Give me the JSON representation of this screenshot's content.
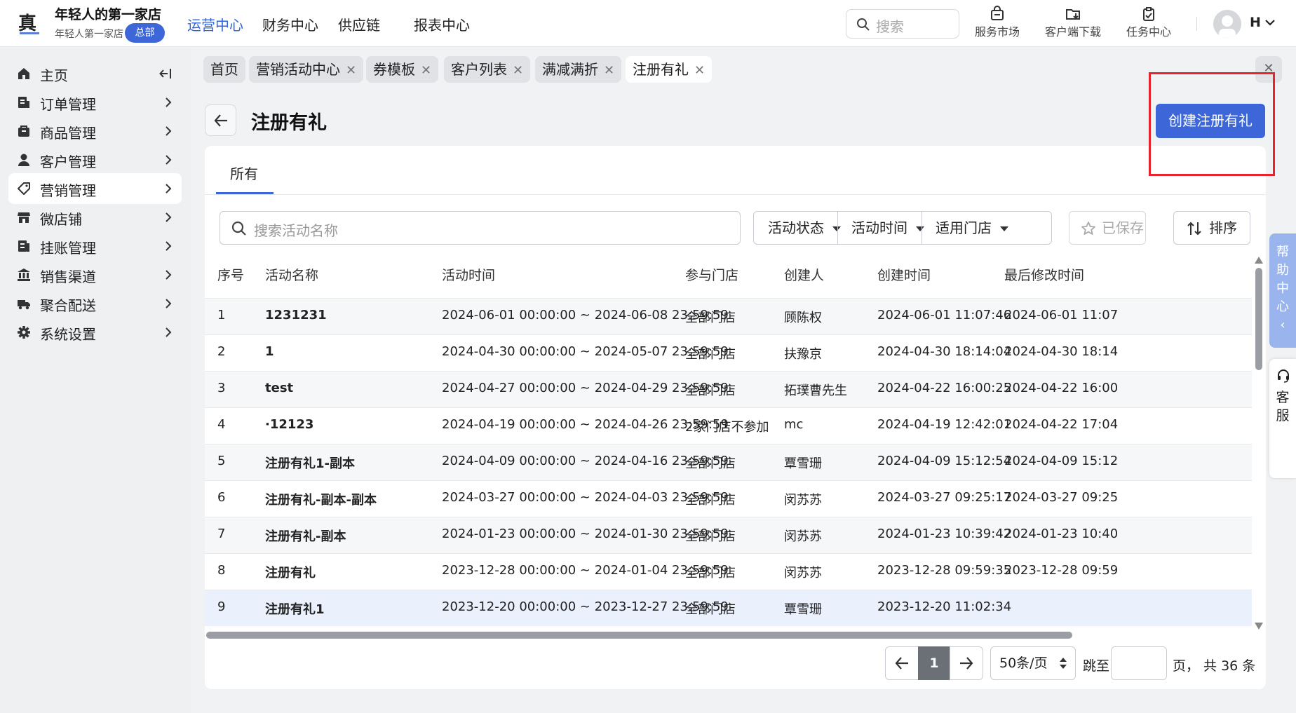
{
  "header": {
    "store_name": "年轻人的第一家店",
    "store_sub": "年轻人第一家店",
    "badge": "总部",
    "nav": [
      "运营中心",
      "财务中心",
      "供应链",
      "报表中心"
    ],
    "active_nav": "运营中心",
    "search_placeholder": "搜索",
    "tools": [
      "服务市场",
      "客户端下载",
      "任务中心"
    ],
    "user_initial": "H"
  },
  "sidebar": {
    "items": [
      {
        "label": "主页",
        "icon": "home-icon"
      },
      {
        "label": "订单管理",
        "icon": "order-icon"
      },
      {
        "label": "商品管理",
        "icon": "product-icon"
      },
      {
        "label": "客户管理",
        "icon": "customer-icon"
      },
      {
        "label": "营销管理",
        "icon": "tag-icon"
      },
      {
        "label": "微店铺",
        "icon": "store-icon"
      },
      {
        "label": "挂账管理",
        "icon": "ledger-icon"
      },
      {
        "label": "销售渠道",
        "icon": "channel-icon"
      },
      {
        "label": "聚合配送",
        "icon": "truck-icon"
      },
      {
        "label": "系统设置",
        "icon": "gear-icon"
      }
    ],
    "active_index": 4
  },
  "tabs": [
    {
      "label": "首页",
      "closable": false
    },
    {
      "label": "营销活动中心",
      "closable": true
    },
    {
      "label": "券模板",
      "closable": true
    },
    {
      "label": "客户列表",
      "closable": true
    },
    {
      "label": "满减满折",
      "closable": true
    },
    {
      "label": "注册有礼",
      "closable": true
    }
  ],
  "page": {
    "title": "注册有礼",
    "create_button": "创建注册有礼",
    "card_tab": "所有",
    "search_placeholder": "搜索活动名称",
    "filters": [
      "活动状态",
      "活动时间",
      "适用门店"
    ],
    "saved_label": "已保存",
    "sort_label": "排序"
  },
  "table": {
    "headers": [
      "序号",
      "活动名称",
      "活动时间",
      "参与门店",
      "创建人",
      "创建时间",
      "最后修改时间"
    ],
    "rows": [
      [
        "1",
        "1231231",
        "2024-06-01 00:00:00 ~ 2024-06-08 23:59:59",
        "全部门店",
        "顾陈权",
        "2024-06-01 11:07:46",
        "2024-06-01 11:07"
      ],
      [
        "2",
        "1",
        "2024-04-30 00:00:00 ~ 2024-05-07 23:59:59",
        "全部门店",
        "扶豫京",
        "2024-04-30 18:14:04",
        "2024-04-30 18:14"
      ],
      [
        "3",
        "test",
        "2024-04-27 00:00:00 ~ 2024-04-29 23:59:59",
        "全部门店",
        "拓璞曹先生",
        "2024-04-22 16:00:25",
        "2024-04-22 16:00"
      ],
      [
        "4",
        "·12123",
        "2024-04-19 00:00:00 ~ 2024-04-26 23:59:59",
        "2家门店不参加",
        "mc",
        "2024-04-19 12:42:01",
        "2024-04-22 17:04"
      ],
      [
        "5",
        "注册有礼1-副本",
        "2024-04-09 00:00:00 ~ 2024-04-16 23:59:59",
        "全部门店",
        "覃雪珊",
        "2024-04-09 15:12:54",
        "2024-04-09 15:12"
      ],
      [
        "6",
        "注册有礼-副本-副本",
        "2024-03-27 00:00:00 ~ 2024-04-03 23:59:59",
        "全部门店",
        "闵苏苏",
        "2024-03-27 09:25:17",
        "2024-03-27 09:25"
      ],
      [
        "7",
        "注册有礼-副本",
        "2024-01-23 00:00:00 ~ 2024-01-30 23:59:59",
        "全部门店",
        "闵苏苏",
        "2024-01-23 10:39:42",
        "2024-01-23 10:40"
      ],
      [
        "8",
        "注册有礼",
        "2023-12-28 00:00:00 ~ 2024-01-04 23:59:59",
        "全部门店",
        "闵苏苏",
        "2023-12-28 09:59:35",
        "2023-12-28 09:59"
      ],
      [
        "9",
        "注册有礼1",
        "2023-12-20 00:00:00 ~ 2023-12-27 23:59:59",
        "全部门店",
        "覃雪珊",
        "2023-12-20 11:02:34",
        ""
      ]
    ]
  },
  "pagination": {
    "current": "1",
    "page_size": "50条/页",
    "jump_label": "跳至",
    "total_label": "页，  共 36 条"
  },
  "floating": {
    "help": [
      "帮",
      "助",
      "中",
      "心"
    ],
    "service": [
      "客",
      "服"
    ]
  },
  "colors": {
    "accent": "#3d67d9",
    "highlight": "#e8232b"
  }
}
